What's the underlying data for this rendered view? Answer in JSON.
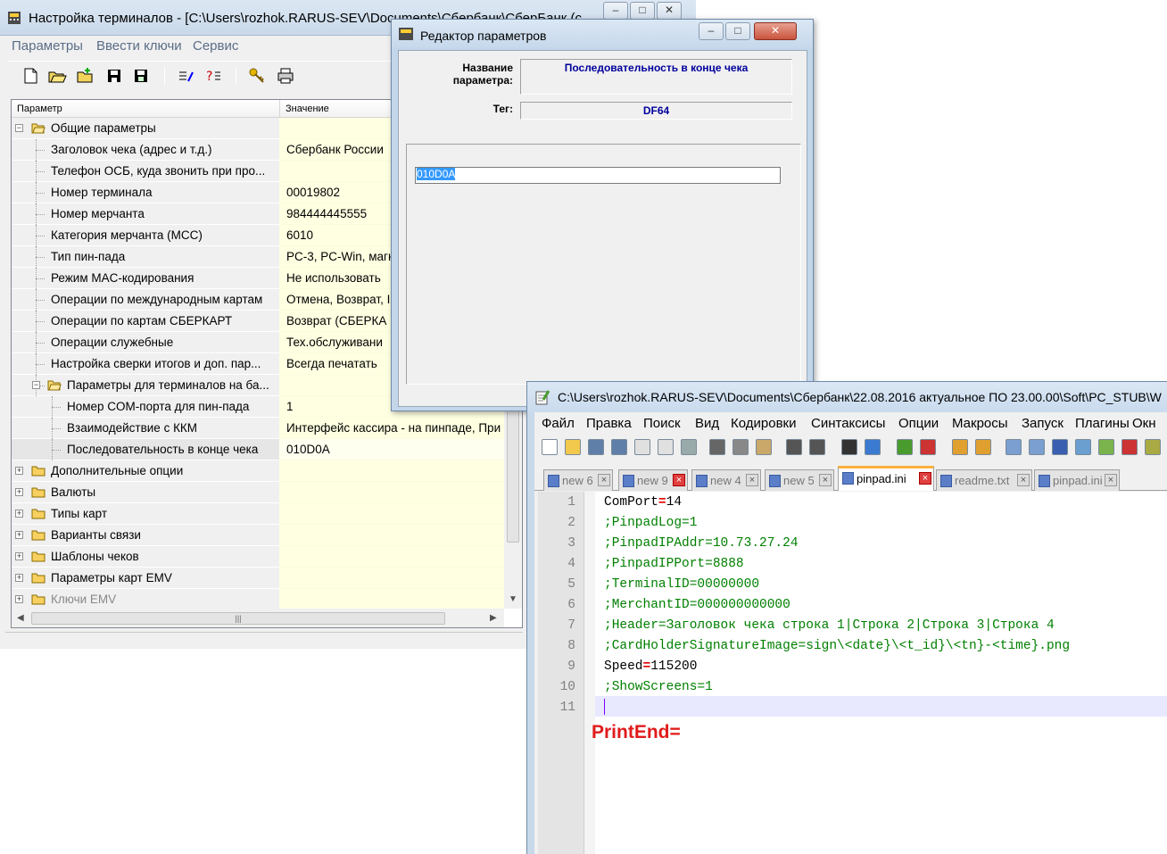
{
  "terminal_window": {
    "title": "Настройка терминалов - [C:\\Users\\rozhok.RARUS-SEV\\Documents\\Сбербанк\\СберБанк (с",
    "menu": [
      "Параметры",
      "Ввести ключи",
      "Сервис"
    ],
    "toolbar_icons": [
      "new-icon",
      "open-icon",
      "import-icon",
      "save-icon",
      "save-all-icon",
      "edit-icon",
      "find-icon",
      "keys-icon",
      "print-icon"
    ],
    "grid_headers": {
      "param": "Параметр",
      "value": "Значение"
    },
    "rows": [
      {
        "label": "Общие параметры",
        "value": "",
        "level": 0,
        "group": true,
        "expanded": true
      },
      {
        "label": "Заголовок чека (адрес и т.д.)",
        "value": "Сбербанк России",
        "level": 1
      },
      {
        "label": "Телефон ОСБ, куда звонить при про...",
        "value": "",
        "level": 1
      },
      {
        "label": "Номер терминала",
        "value": "00019802",
        "level": 1
      },
      {
        "label": "Номер мерчанта",
        "value": "984444445555",
        "level": 1
      },
      {
        "label": "Категория мерчанта (MCC)",
        "value": "6010",
        "level": 1
      },
      {
        "label": "Тип пин-пада",
        "value": "PC-3, PC-Win, магн",
        "level": 1
      },
      {
        "label": "Режим MAC-кодирования",
        "value": "Не использовать",
        "level": 1
      },
      {
        "label": "Операции по международным картам",
        "value": "Отмена, Возврат, I",
        "level": 1
      },
      {
        "label": "Операции по картам СБЕРКАРТ",
        "value": "Возврат (СБЕРКА",
        "level": 1
      },
      {
        "label": "Операции служебные",
        "value": "Тех.обслуживани",
        "level": 1
      },
      {
        "label": "Настройка сверки итогов и доп. пар...",
        "value": "Всегда печатать",
        "level": 1
      },
      {
        "label": "Параметры для терминалов на ба...",
        "value": "",
        "level": 1,
        "group": true,
        "expanded": true
      },
      {
        "label": "Номер COM-порта для пин-пада",
        "value": "1",
        "level": 2
      },
      {
        "label": "Взаимодействие с ККМ",
        "value": "Интерфейс кассира - на пинпаде, При",
        "level": 2
      },
      {
        "label": "Последовательность в конце чека",
        "value": "010D0A",
        "level": 2,
        "selected": true
      },
      {
        "label": "Дополнительные опции",
        "value": "",
        "level": 0,
        "group": true
      },
      {
        "label": "Валюты",
        "value": "",
        "level": 0,
        "group": true
      },
      {
        "label": "Типы карт",
        "value": "",
        "level": 0,
        "group": true
      },
      {
        "label": "Варианты связи",
        "value": "",
        "level": 0,
        "group": true
      },
      {
        "label": "Шаблоны чеков",
        "value": "",
        "level": 0,
        "group": true
      },
      {
        "label": "Параметры карт EMV",
        "value": "",
        "level": 0,
        "group": true
      },
      {
        "label": "Ключи EMV",
        "value": "",
        "level": 0,
        "group": true,
        "dim": true
      }
    ]
  },
  "param_editor": {
    "title": "Редактор параметров",
    "name_label": "Название\nпараметра:",
    "name_value": "Последовательность в конце чека",
    "tag_label": "Тег:",
    "tag_value": "DF64",
    "input_value": "010D0A"
  },
  "notepad": {
    "title": "C:\\Users\\rozhok.RARUS-SEV\\Documents\\Сбербанк\\22.08.2016 актуальное ПО 23.00.00\\Soft\\PC_STUB\\W",
    "menu": [
      "Файл",
      "Правка",
      "Поиск",
      "Вид",
      "Кодировки",
      "Синтаксисы",
      "Опции",
      "Макросы",
      "Запуск",
      "Плагины",
      "Окн"
    ],
    "tabs": [
      {
        "label": "new 6",
        "active": false
      },
      {
        "label": "new 9",
        "active": false
      },
      {
        "label": "new 4",
        "active": false
      },
      {
        "label": "new 5",
        "active": false
      },
      {
        "label": "pinpad.ini",
        "active": true
      },
      {
        "label": "readme.txt",
        "active": false
      },
      {
        "label": "pinpad.ini",
        "active": false
      }
    ],
    "lines": [
      {
        "n": "1",
        "key": "ComPort",
        "val": "14",
        "comment": false
      },
      {
        "n": "2",
        "text": ";PinpadLog=1",
        "comment": true
      },
      {
        "n": "3",
        "text": ";PinpadIPAddr=10.73.27.24",
        "comment": true
      },
      {
        "n": "4",
        "text": ";PinpadIPPort=8888",
        "comment": true
      },
      {
        "n": "5",
        "text": ";TerminalID=00000000",
        "comment": true
      },
      {
        "n": "6",
        "text": ";MerchantID=000000000000",
        "comment": true
      },
      {
        "n": "7",
        "text": ";Header=Заголовок чека строка 1|Строка 2|Строка 3|Строка 4",
        "comment": true
      },
      {
        "n": "8",
        "text": ";CardHolderSignatureImage=sign\\<date}\\<t_id}\\<tn}-<time}.png",
        "comment": true
      },
      {
        "n": "9",
        "key": "Speed",
        "val": "115200",
        "comment": false
      },
      {
        "n": "10",
        "text": ";ShowScreens=1",
        "comment": true
      },
      {
        "n": "11",
        "text": "",
        "comment": true
      }
    ],
    "annotation": "PrintEnd="
  },
  "colors": {
    "value_cell": "#ffffe1",
    "comment": "#008000",
    "operator": "#e00000",
    "annotation": "#e01b1b",
    "tag_text": "#00009c"
  }
}
